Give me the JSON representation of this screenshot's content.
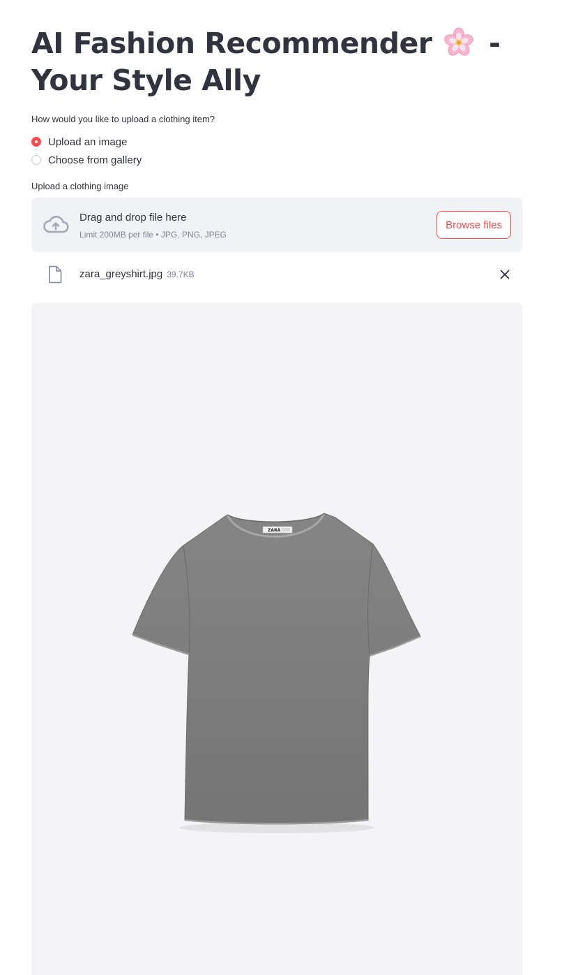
{
  "header": {
    "title_before_icon": "AI Fashion Recommender",
    "title_after_icon": "- Your Style Ally",
    "title_icon": "cherry-blossom-icon"
  },
  "upload_method": {
    "question": "How would you like to upload a clothing item?",
    "options": [
      {
        "label": "Upload an image",
        "selected": true
      },
      {
        "label": "Choose from gallery",
        "selected": false
      }
    ]
  },
  "uploader": {
    "label": "Upload a clothing image",
    "drop_text": "Drag and drop file here",
    "limit_text": "Limit 200MB per file • JPG, PNG, JPEG",
    "browse_label": "Browse files",
    "icon": "cloud-upload-icon"
  },
  "uploaded_file": {
    "name": "zara_greyshirt.jpg",
    "size": "39.7KB",
    "icon": "file-icon",
    "remove_icon": "close-icon"
  },
  "preview": {
    "image": "grey-t-shirt-image",
    "label_text": "ZARA"
  },
  "colors": {
    "accent": "#ff4b4b",
    "text": "#31333f",
    "muted": "#808495",
    "dropzone_bg": "#f0f2f6",
    "preview_bg": "#f4f4f6",
    "shirt": "#7c7c7c"
  }
}
